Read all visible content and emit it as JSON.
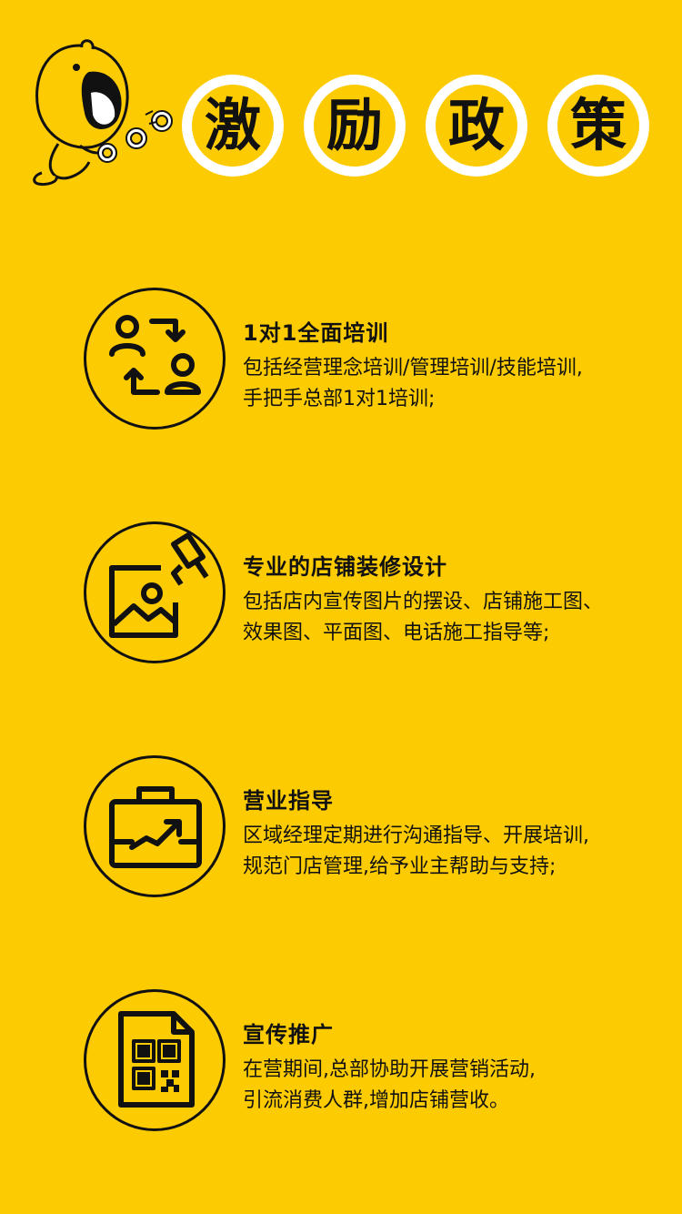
{
  "colors": {
    "background": "#FDCB02",
    "ink": "#111111",
    "white": "#FFFFFF"
  },
  "header": {
    "mascot_icon": "yelling-mascot-with-coins",
    "title_chars": [
      "激",
      "励",
      "政",
      "策"
    ]
  },
  "items": [
    {
      "icon": "exchange-people-icon",
      "title": "1对1全面培训",
      "desc_lines": [
        "包括经营理念培训/管理培训/技能培训,",
        "手把手总部1对1培训;"
      ]
    },
    {
      "icon": "picture-paint-roller-icon",
      "title": "专业的店铺装修设计",
      "desc_lines": [
        "包括店内宣传图片的摆设、店铺施工图、",
        "效果图、平面图、电话施工指导等;"
      ]
    },
    {
      "icon": "briefcase-growth-icon",
      "title": "营业指导",
      "desc_lines": [
        "区域经理定期进行沟通指导、开展培训,",
        "规范门店管理,给予业主帮助与支持;"
      ]
    },
    {
      "icon": "qr-document-icon",
      "title": "宣传推广",
      "desc_lines": [
        "在营期间,总部协助开展营销活动,",
        "引流消费人群,增加店铺营收。"
      ]
    }
  ]
}
